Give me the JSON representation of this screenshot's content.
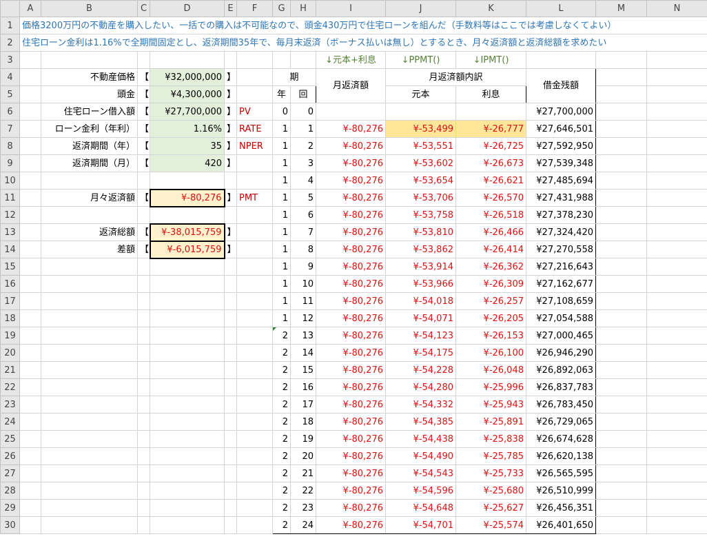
{
  "columns": [
    "A",
    "B",
    "C",
    "D",
    "E",
    "F",
    "G",
    "H",
    "I",
    "J",
    "K",
    "L",
    "M",
    "N"
  ],
  "row_numbers": [
    1,
    2,
    3,
    4,
    5,
    6,
    7,
    8,
    9,
    10,
    11,
    12,
    13,
    14,
    15,
    16,
    17,
    18,
    19,
    20,
    21,
    22,
    23,
    24,
    25,
    26,
    27,
    28,
    29,
    30
  ],
  "notes": {
    "row1": "価格3200万円の不動産を購入したい、一括での購入は不可能なので、頭金430万円で住宅ローンを組んだ（手数料等はここでは考慮しなくてよい）",
    "row2": "住宅ローン金利は1.16%で全期間固定とし、返済期間35年で、毎月末返済（ボーナス払いは無し）とするとき、月々返済額と返済総額を求めたい"
  },
  "hints": {
    "i3": "↓元本+利息",
    "j3": "↓PPMT()",
    "k3": "↓IPMT()"
  },
  "inputs": {
    "r4": {
      "label": "不動産価格",
      "open": "【",
      "value": "¥32,000,000",
      "close": "】",
      "tag": ""
    },
    "r5": {
      "label": "頭金",
      "open": "【",
      "value": "¥4,300,000",
      "close": "】",
      "tag": ""
    },
    "r6": {
      "label": "住宅ローン借入額",
      "open": "【",
      "value": "¥27,700,000",
      "close": "】",
      "tag": "PV"
    },
    "r7": {
      "label": "ローン金利（年利）",
      "open": "【",
      "value": "1.16%",
      "close": "】",
      "tag": "RATE"
    },
    "r8": {
      "label": "返済期間（年）",
      "open": "【",
      "value": "35",
      "close": "】",
      "tag": "NPER"
    },
    "r9": {
      "label": "返済期間（月）",
      "open": "【",
      "value": "420",
      "close": "】",
      "tag": ""
    },
    "r11": {
      "label": "月々返済額",
      "open": "【",
      "value": "¥-80,276",
      "close": "】",
      "tag": "PMT"
    },
    "r13": {
      "label": "返済総額",
      "open": "【",
      "value": "¥-38,015,759",
      "close": "】",
      "tag": ""
    },
    "r14": {
      "label": "差額",
      "open": "【",
      "value": "¥-6,015,759",
      "close": "】",
      "tag": ""
    }
  },
  "schedule": {
    "headers": {
      "period": "期",
      "year": "年",
      "count": "回",
      "payment": "月返済額",
      "breakdown": "月返済額内訳",
      "principal": "元本",
      "interest": "利息",
      "balance": "借金残額"
    },
    "rows": [
      {
        "year": "0",
        "n": "0",
        "pay": "",
        "prin": "",
        "int": "",
        "bal": "¥27,700,000"
      },
      {
        "year": "1",
        "n": "1",
        "pay": "¥-80,276",
        "prin": "¥-53,499",
        "int": "¥-26,777",
        "bal": "¥27,646,501"
      },
      {
        "year": "1",
        "n": "2",
        "pay": "¥-80,276",
        "prin": "¥-53,551",
        "int": "¥-26,725",
        "bal": "¥27,592,950"
      },
      {
        "year": "1",
        "n": "3",
        "pay": "¥-80,276",
        "prin": "¥-53,602",
        "int": "¥-26,673",
        "bal": "¥27,539,348"
      },
      {
        "year": "1",
        "n": "4",
        "pay": "¥-80,276",
        "prin": "¥-53,654",
        "int": "¥-26,621",
        "bal": "¥27,485,694"
      },
      {
        "year": "1",
        "n": "5",
        "pay": "¥-80,276",
        "prin": "¥-53,706",
        "int": "¥-26,570",
        "bal": "¥27,431,988"
      },
      {
        "year": "1",
        "n": "6",
        "pay": "¥-80,276",
        "prin": "¥-53,758",
        "int": "¥-26,518",
        "bal": "¥27,378,230"
      },
      {
        "year": "1",
        "n": "7",
        "pay": "¥-80,276",
        "prin": "¥-53,810",
        "int": "¥-26,466",
        "bal": "¥27,324,420"
      },
      {
        "year": "1",
        "n": "8",
        "pay": "¥-80,276",
        "prin": "¥-53,862",
        "int": "¥-26,414",
        "bal": "¥27,270,558"
      },
      {
        "year": "1",
        "n": "9",
        "pay": "¥-80,276",
        "prin": "¥-53,914",
        "int": "¥-26,362",
        "bal": "¥27,216,643"
      },
      {
        "year": "1",
        "n": "10",
        "pay": "¥-80,276",
        "prin": "¥-53,966",
        "int": "¥-26,309",
        "bal": "¥27,162,677"
      },
      {
        "year": "1",
        "n": "11",
        "pay": "¥-80,276",
        "prin": "¥-54,018",
        "int": "¥-26,257",
        "bal": "¥27,108,659"
      },
      {
        "year": "1",
        "n": "12",
        "pay": "¥-80,276",
        "prin": "¥-54,071",
        "int": "¥-26,205",
        "bal": "¥27,054,588"
      },
      {
        "year": "2",
        "n": "13",
        "pay": "¥-80,276",
        "prin": "¥-54,123",
        "int": "¥-26,153",
        "bal": "¥27,000,465"
      },
      {
        "year": "2",
        "n": "14",
        "pay": "¥-80,276",
        "prin": "¥-54,175",
        "int": "¥-26,100",
        "bal": "¥26,946,290"
      },
      {
        "year": "2",
        "n": "15",
        "pay": "¥-80,276",
        "prin": "¥-54,228",
        "int": "¥-26,048",
        "bal": "¥26,892,063"
      },
      {
        "year": "2",
        "n": "16",
        "pay": "¥-80,276",
        "prin": "¥-54,280",
        "int": "¥-25,996",
        "bal": "¥26,837,783"
      },
      {
        "year": "2",
        "n": "17",
        "pay": "¥-80,276",
        "prin": "¥-54,332",
        "int": "¥-25,943",
        "bal": "¥26,783,450"
      },
      {
        "year": "2",
        "n": "18",
        "pay": "¥-80,276",
        "prin": "¥-54,385",
        "int": "¥-25,891",
        "bal": "¥26,729,065"
      },
      {
        "year": "2",
        "n": "19",
        "pay": "¥-80,276",
        "prin": "¥-54,438",
        "int": "¥-25,838",
        "bal": "¥26,674,628"
      },
      {
        "year": "2",
        "n": "20",
        "pay": "¥-80,276",
        "prin": "¥-54,490",
        "int": "¥-25,785",
        "bal": "¥26,620,138"
      },
      {
        "year": "2",
        "n": "21",
        "pay": "¥-80,276",
        "prin": "¥-54,543",
        "int": "¥-25,733",
        "bal": "¥26,565,595"
      },
      {
        "year": "2",
        "n": "22",
        "pay": "¥-80,276",
        "prin": "¥-54,596",
        "int": "¥-25,680",
        "bal": "¥26,510,999"
      },
      {
        "year": "2",
        "n": "23",
        "pay": "¥-80,276",
        "prin": "¥-54,648",
        "int": "¥-25,627",
        "bal": "¥26,456,351"
      },
      {
        "year": "2",
        "n": "24",
        "pay": "¥-80,276",
        "prin": "¥-54,701",
        "int": "¥-25,574",
        "bal": "¥26,401,650"
      }
    ]
  },
  "colors": {
    "note_blue": "#2e75b6",
    "hint_green": "#548235",
    "negative_red": "#e01010",
    "tag_maroon": "#c00000",
    "input_green_bg": "#e2efda",
    "result_yellow_bg": "#fff2cc",
    "highlight_orange_bg": "#ffe699"
  }
}
